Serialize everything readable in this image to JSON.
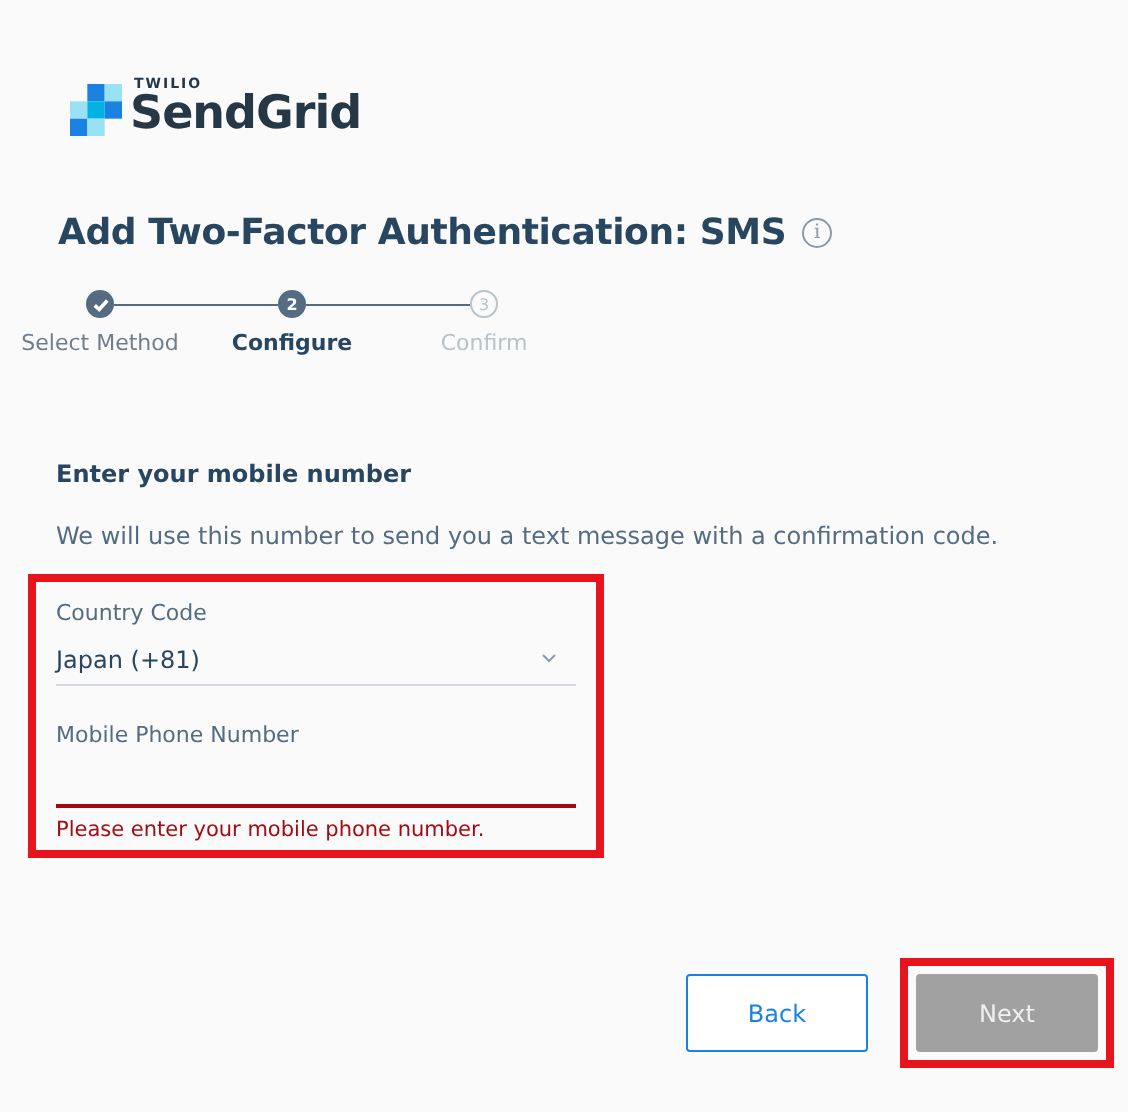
{
  "logo": {
    "brand_small": "TWILIO",
    "brand": "SendGrid"
  },
  "title": "Add Two-Factor Authentication: SMS",
  "info_icon": "i",
  "steps": [
    {
      "label": "Select Method",
      "completed": true,
      "selected": false
    },
    {
      "number": "2",
      "label": "Configure",
      "completed": false,
      "selected": true
    },
    {
      "number": "3",
      "label": "Confirm",
      "completed": false,
      "selected": false
    }
  ],
  "section_heading": "Enter your mobile number",
  "description": "We will use this number to send you a text message with a confirmation code.",
  "form": {
    "highlighted": true,
    "fields": [
      {
        "kind": "select",
        "label": "Country Code",
        "value": "Japan (+81)"
      },
      {
        "kind": "input",
        "label": "Mobile Phone Number",
        "error": "Please enter your mobile phone number."
      }
    ]
  },
  "buttons": [
    {
      "label": "Back",
      "kind": "secondary",
      "disabled": false,
      "highlighted": false
    },
    {
      "label": "Next",
      "kind": "primary",
      "disabled": true,
      "highlighted": true
    }
  ]
}
